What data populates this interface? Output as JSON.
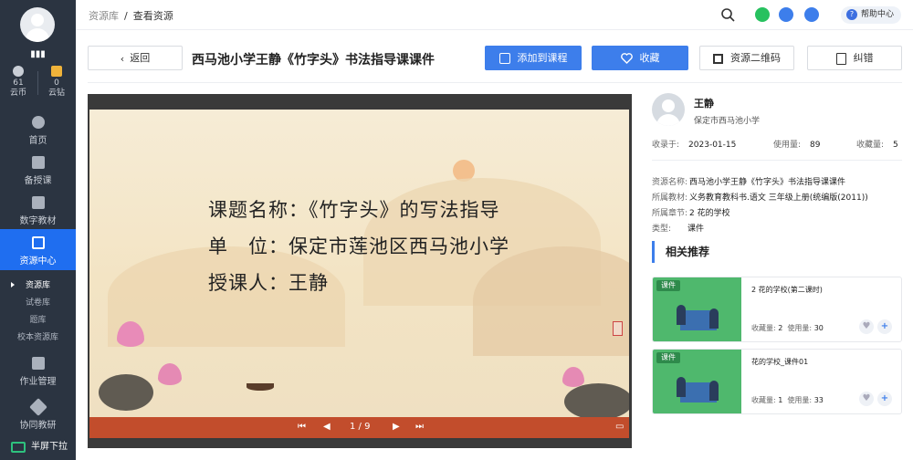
{
  "sidebar": {
    "user_name": "▮▮▮",
    "stats": [
      {
        "value": "61",
        "label": "云币",
        "icon": "coin-icon",
        "color": "#c9ced6"
      },
      {
        "value": "0",
        "label": "云钻",
        "icon": "diamond-icon",
        "color": "#f0b33a"
      }
    ],
    "nav": [
      {
        "label": "首页",
        "icon": "home-icon"
      },
      {
        "label": "备授课",
        "icon": "lesson-icon"
      },
      {
        "label": "数字教材",
        "icon": "book-icon"
      },
      {
        "label": "资源中心",
        "icon": "resource-icon"
      },
      {
        "label": "作业管理",
        "icon": "homework-icon"
      },
      {
        "label": "协同教研",
        "icon": "handshake-icon"
      }
    ],
    "sub_items": [
      "资源库",
      "试卷库",
      "题库",
      "校本资源库"
    ],
    "half_screen": "半屏下拉"
  },
  "header": {
    "breadcrumb": [
      "资源库",
      "查看资源"
    ],
    "help": "帮助中心",
    "icons": [
      "search-icon",
      "wechat-icon",
      "mail-icon",
      "headset-icon"
    ]
  },
  "toolbar": {
    "back": "返回",
    "title": "西马池小学王静《竹字头》书法指导课课件",
    "add_to_course": "添加到课程",
    "favorite": "收藏",
    "qrcode": "资源二维码",
    "report": "纠错"
  },
  "slide": {
    "line1": "课题名称：《竹字头》的写法指导",
    "line2": "单　位：保定市莲池区西马池小学",
    "line3": "授课人：王静",
    "page": "1 / 9"
  },
  "author": {
    "name": "王静",
    "school": "保定市西马池小学",
    "collected_label": "收录于:",
    "collected_date": "2023-01-15",
    "usage_label": "使用量:",
    "usage": "89",
    "favorites_label": "收藏量:",
    "favorites": "5"
  },
  "info": {
    "name_label": "资源名称:",
    "name": "西马池小学王静《竹字头》书法指导课课件",
    "textbook_label": "所属教材:",
    "textbook": "义务教育教科书.语文 三年级上册(统编版(2011))",
    "chapter_label": "所属章节:",
    "chapter": "2 花的学校",
    "type_label": "类型:",
    "type": "课件"
  },
  "recommend": {
    "title": "相关推荐",
    "cards": [
      {
        "tag": "课件",
        "title": "2 花的学校(第二课时)",
        "fav_label": "收藏量:",
        "fav": "2",
        "use_label": "使用量:",
        "use": "30"
      },
      {
        "tag": "课件",
        "title": "花的学校_课件01",
        "fav_label": "收藏量:",
        "fav": "1",
        "use_label": "使用量:",
        "use": "33"
      }
    ]
  }
}
